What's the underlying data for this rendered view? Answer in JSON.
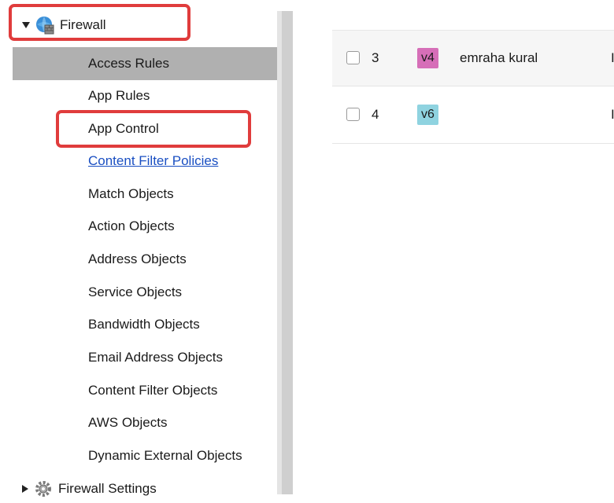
{
  "sidebar": {
    "firewall_label": "Firewall",
    "items": [
      {
        "label": "Access Rules"
      },
      {
        "label": "App Rules"
      },
      {
        "label": "App Control"
      },
      {
        "label": "Content Filter Policies"
      },
      {
        "label": "Match Objects"
      },
      {
        "label": "Action Objects"
      },
      {
        "label": "Address Objects"
      },
      {
        "label": "Service Objects"
      },
      {
        "label": "Bandwidth Objects"
      },
      {
        "label": "Email Address Objects"
      },
      {
        "label": "Content Filter Objects"
      },
      {
        "label": "AWS Objects"
      },
      {
        "label": "Dynamic External Objects"
      }
    ],
    "next_group_label": "Firewall Settings",
    "active_index": 0,
    "highlight_color": "#e03c3c",
    "active_bg": "#b0b0b0"
  },
  "table": {
    "rows": [
      {
        "index": "3",
        "ip_version": "v4",
        "name": "emraha kural",
        "trailing": "I"
      },
      {
        "index": "4",
        "ip_version": "v6",
        "name": "",
        "trailing": "I"
      }
    ],
    "badge_colors": {
      "v4": "#d66fb8",
      "v6": "#8fd3e0"
    }
  }
}
